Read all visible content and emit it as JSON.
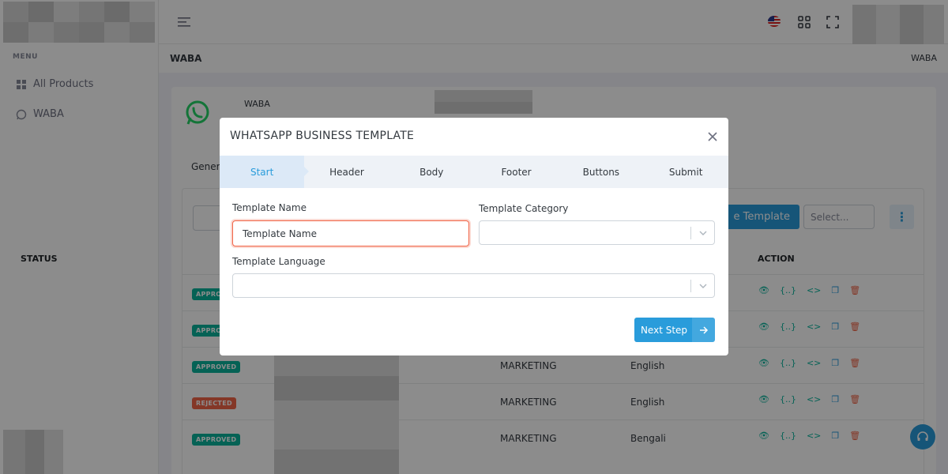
{
  "colors": {
    "accent": "#299cdb",
    "success": "#0ab39c",
    "danger": "#f06548",
    "overlay": "rgba(0,0,0,0.45)"
  },
  "sidebar": {
    "menu_title": "MENU",
    "items": [
      {
        "label": "All Products",
        "icon": "grid-icon"
      },
      {
        "label": "WABA",
        "icon": "whatsapp-icon"
      }
    ]
  },
  "topbar": {
    "icons": [
      "hamburger-icon",
      "us-flag-icon",
      "apps-grid-icon",
      "fullscreen-icon"
    ]
  },
  "pagebar": {
    "title": "WABA",
    "breadcrumb": "WABA"
  },
  "card": {
    "account_label": "WABA",
    "tab_partial": "Gener",
    "create_button_partial": "e Template",
    "select_placeholder": "Select...",
    "table": {
      "header_status": "STATUS",
      "header_action": "ACTION",
      "rows": [
        {
          "status": "APPROVED",
          "category": "",
          "language": ""
        },
        {
          "status": "APPROVED",
          "category": "",
          "language": ""
        },
        {
          "status": "APPROVED",
          "category": "MARKETING",
          "language": "English"
        },
        {
          "status": "REJECTED",
          "category": "MARKETING",
          "language": "English"
        },
        {
          "status": "APPROVED",
          "category": "MARKETING",
          "language": "Bengali"
        }
      ]
    }
  },
  "modal": {
    "title": "WHATSAPP BUSINESS TEMPLATE",
    "steps": [
      "Start",
      "Header",
      "Body",
      "Footer",
      "Buttons",
      "Submit"
    ],
    "active_step": "Start",
    "fields": {
      "template_name_label": "Template Name",
      "template_name_value": "Template Name",
      "template_category_label": "Template Category",
      "template_category_value": "",
      "template_language_label": "Template Language",
      "template_language_value": ""
    },
    "next_button_label": "Next Step"
  }
}
